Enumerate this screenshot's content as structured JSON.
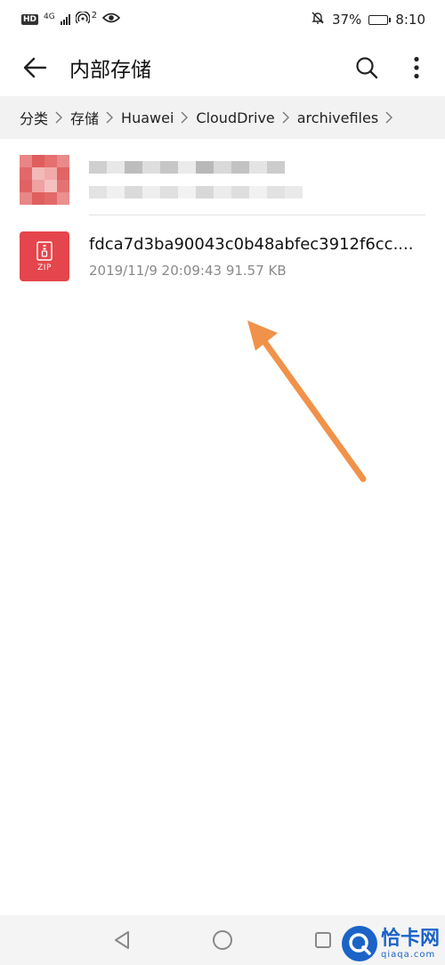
{
  "status_bar": {
    "hd_badge": "HD",
    "network_type": "4G",
    "hotspot_count": "2",
    "battery_percent": "37%",
    "battery_level": 0.37,
    "time": "8:10"
  },
  "app_bar": {
    "title": "内部存储"
  },
  "breadcrumb": {
    "items": [
      "分类",
      "存储",
      "Huawei",
      "CloudDrive",
      "archivefiles"
    ]
  },
  "files": [
    {
      "name": "",
      "meta": "",
      "obscured": true
    },
    {
      "name": "fdca7d3ba90043c0b48abfec3912f6cc....",
      "meta": "2019/11/9 20:09:43 91.57 KB",
      "type_label": "ZIP",
      "icon": "zip-file-icon"
    }
  ],
  "watermark": {
    "title": "恰卡网",
    "subtitle": "qiaqa.com"
  },
  "colors": {
    "zip_icon": "#e5454c",
    "arrow": "#f0924a",
    "breadcrumb_bg": "#f2f2f2",
    "watermark": "#1c63c8"
  }
}
